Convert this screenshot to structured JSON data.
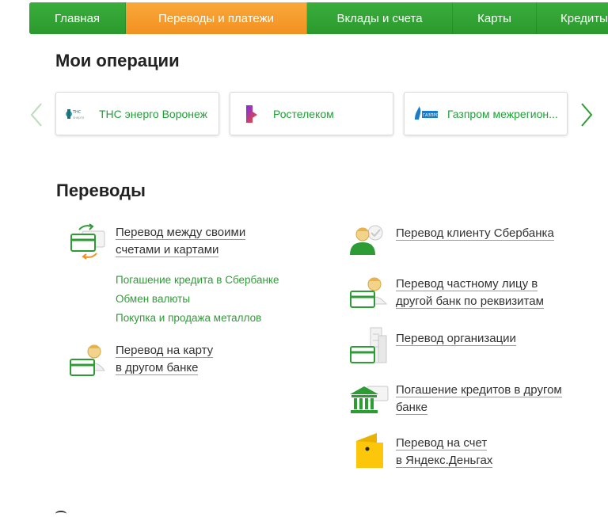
{
  "nav": {
    "tabs": [
      {
        "label": "Главная"
      },
      {
        "label": "Переводы и платежи"
      },
      {
        "label": "Вклады и счета"
      },
      {
        "label": "Карты"
      },
      {
        "label": "Кредиты"
      }
    ],
    "active_tab": "Переводы и платежи",
    "colors": {
      "green": "#2fa232",
      "active_orange": "#f29121"
    }
  },
  "operations": {
    "title": "Мои операции",
    "cards": [
      {
        "label": "ТНС энерго Воронеж",
        "logo": "tns-energo-logo"
      },
      {
        "label": "Ростелеком",
        "logo": "rostelecom-logo"
      },
      {
        "label": "Газпром межрегион...",
        "logo": "gazprom-logo"
      }
    ]
  },
  "transfers": {
    "title": "Переводы",
    "left": [
      {
        "line1": "Перевод между своими",
        "line2": "счетами и картами",
        "icon": "own-accounts-transfer-icon"
      },
      {
        "line1": "Перевод на карту",
        "line2": "в другом банке",
        "icon": "card-other-bank-icon"
      }
    ],
    "sublinks": [
      "Погашение кредита в Сбербанке",
      "Обмен валюты",
      "Покупка и продажа металлов"
    ],
    "right": [
      {
        "line1": "Перевод клиенту Сбербанка",
        "line2": "",
        "icon": "sber-client-icon"
      },
      {
        "line1": "Перевод частному лицу в",
        "line2": "другой банк по реквизитам",
        "icon": "private-person-icon"
      },
      {
        "line1": "Перевод организации",
        "line2": "",
        "icon": "organization-icon"
      },
      {
        "line1": "Погашение кредитов в другом",
        "line2": "банке",
        "icon": "bank-building-icon"
      },
      {
        "line1": "Перевод на счет",
        "line2": "в Яндекс.Деньгах",
        "icon": "yandex-money-icon"
      }
    ]
  }
}
